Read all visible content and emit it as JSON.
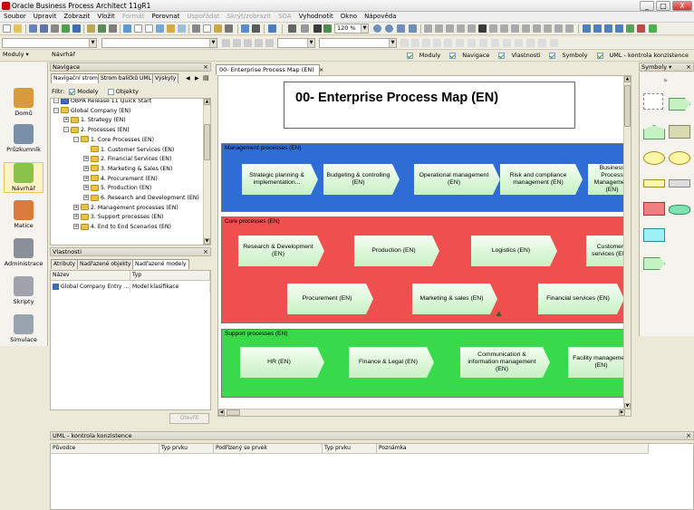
{
  "window": {
    "title": "Oracle Business Process Architect 11gR1",
    "controls": [
      "_",
      "□",
      "X"
    ]
  },
  "menu": [
    {
      "label": "Soubor",
      "enabled": true
    },
    {
      "label": "Upravit",
      "enabled": true
    },
    {
      "label": "Zobrazit",
      "enabled": true
    },
    {
      "label": "Vložit",
      "enabled": true
    },
    {
      "label": "Formát",
      "enabled": false
    },
    {
      "label": "Porovnat",
      "enabled": true
    },
    {
      "label": "Uspořádat",
      "enabled": false
    },
    {
      "label": "Skrýt/zobrazit",
      "enabled": false
    },
    {
      "label": "SOA",
      "enabled": false
    },
    {
      "label": "Vyhodnotit",
      "enabled": true
    },
    {
      "label": "Okno",
      "enabled": true
    },
    {
      "label": "Nápověda",
      "enabled": true
    }
  ],
  "toolbar": {
    "zoom": "120 %",
    "toggles": [
      {
        "label": "Moduly",
        "checked": true
      },
      {
        "label": "Navigace",
        "checked": true
      },
      {
        "label": "Vlastnosti",
        "checked": true
      },
      {
        "label": "Symboly",
        "checked": true
      },
      {
        "label": "UML - kontrola konzistence",
        "checked": true
      }
    ]
  },
  "modules": {
    "header": "Moduly",
    "items": [
      {
        "label": "Domů",
        "color": "#d89a3a"
      },
      {
        "label": "Průzkumník",
        "color": "#7a8fa8"
      },
      {
        "label": "Návrhář",
        "color": "#8bc34a"
      },
      {
        "label": "Matice",
        "color": "#d97b3c"
      },
      {
        "label": "Administrace",
        "color": "#8a8f99"
      },
      {
        "label": "Skripty",
        "color": "#a0a3ab"
      },
      {
        "label": "Simulace",
        "color": "#9aa3b0"
      }
    ],
    "selected": "Návrhář"
  },
  "designer_bar": {
    "label": "Návrhář"
  },
  "navigation": {
    "header": "Navigace",
    "tabs": [
      "Navigační strom",
      "Strom balíčků UML",
      "Výskyty"
    ],
    "filter_label": "Filtr:",
    "filters": [
      {
        "label": "Modely",
        "checked": true
      },
      {
        "label": "Objekty",
        "checked": false
      }
    ],
    "tree": [
      {
        "level": 0,
        "label": "OBPA Release 11 Quick Start",
        "exp": "-",
        "folder": false
      },
      {
        "level": 0,
        "label": "Global Company (EN)",
        "exp": "-",
        "folder": true
      },
      {
        "level": 1,
        "label": "1. Strategy (EN)",
        "exp": "+",
        "folder": true
      },
      {
        "level": 1,
        "label": "2. Processes (EN)",
        "exp": "-",
        "folder": true
      },
      {
        "level": 2,
        "label": "1. Core Processes (EN)",
        "exp": "-",
        "folder": true
      },
      {
        "level": 3,
        "label": "1. Customer Services (EN)",
        "exp": "",
        "folder": true
      },
      {
        "level": 3,
        "label": "2. Financial Services (EN)",
        "exp": "+",
        "folder": true
      },
      {
        "level": 3,
        "label": "3. Marketing & Sales (EN)",
        "exp": "+",
        "folder": true
      },
      {
        "level": 3,
        "label": "4. Procurement (EN)",
        "exp": "+",
        "folder": true
      },
      {
        "level": 3,
        "label": "5. Production (EN)",
        "exp": "+",
        "folder": true
      },
      {
        "level": 3,
        "label": "6. Research and Development (EN)",
        "exp": "+",
        "folder": true
      },
      {
        "level": 2,
        "label": "2. Management processes (EN)",
        "exp": "+",
        "folder": true
      },
      {
        "level": 2,
        "label": "3. Support processes (EN)",
        "exp": "+",
        "folder": true
      },
      {
        "level": 2,
        "label": "4. End to End Scenarios (EN)",
        "exp": "+",
        "folder": true
      }
    ]
  },
  "properties": {
    "header": "Vlastnosti",
    "tabs": [
      "Atributy",
      "Nadřazené objekty",
      "Nadřazené modely"
    ],
    "columns": [
      "Název",
      "Typ"
    ],
    "rows": [
      {
        "name": "Global Company Entry ...",
        "type": "Model klasifikace"
      }
    ],
    "open_button": "Otevřít"
  },
  "editor": {
    "tab": "00- Enterprise Process Map (EN)",
    "title": "00- Enterprise Process Map (EN)"
  },
  "diagram": {
    "bands": [
      {
        "label": "Management processes (EN)",
        "color": "#2f6cd6",
        "items": [
          "Strategic planning & implementation...",
          "Budgeting & controlling (EN)",
          "Operational management (EN)",
          "Risk and compliance management (EN)",
          "Business Process Management (EN)"
        ]
      },
      {
        "label": "Core processes (EN)",
        "color": "#ef4f4f",
        "items": [
          "Research & Development (EN)",
          "Production (EN)",
          "Logistics (EN)",
          "Customer services (EN)",
          "Procurement (EN)",
          "Marketing & sales (EN)",
          "Financial services (EN)"
        ]
      },
      {
        "label": "Support processes (EN)",
        "color": "#38d94a",
        "items": [
          "HR (EN)",
          "Finance & Legal (EN)",
          "Communication & information management (EN)",
          "Facility management (EN)"
        ]
      }
    ]
  },
  "symbols": {
    "header": "Symboly"
  },
  "uml": {
    "header": "UML - kontrola konzistence",
    "columns": [
      "Původce",
      "Typ prvku",
      "Podřízený se prvek",
      "Typ prvku",
      "Poznámka"
    ]
  }
}
